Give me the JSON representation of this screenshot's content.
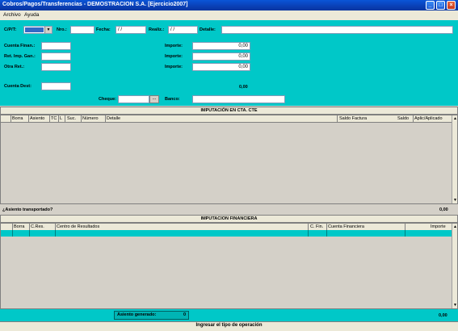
{
  "window": {
    "title": "Cobros/Pagos/Transferencias - DEMOSTRACION S.A.  [Ejercicio2007]",
    "minimize_glyph": "_",
    "maximize_glyph": "□",
    "close_glyph": "×"
  },
  "menu": {
    "file": "Archivo",
    "help": "Ayuda"
  },
  "form": {
    "cpt_label": "C/P/T:",
    "nro_label": "Nro.:",
    "fecha_label": "Fecha:",
    "fecha_value": " / /",
    "realiz_label": "Realiz.:",
    "realiz_value": " / /",
    "detalle_label": "Detalle:",
    "cuenta_finan_label": "Cuenta Finan.:",
    "ret_imp_label": "Ret. Imp. Gan.:",
    "otra_ret_label": "Otra Ret.:",
    "importe_label_1": "Importe:",
    "importe_label_2": "Importe:",
    "importe_label_3": "Importe:",
    "importe_value_1": "0,00",
    "importe_value_2": "0,00",
    "importe_value_3": "0,00",
    "cuenta_dest_label": "Cuenta Dest:",
    "total_value": "0,00",
    "cheque_label": "Cheque:",
    "cheque_button": "...",
    "banco_label": "Banco:"
  },
  "cta_cte": {
    "header": "IMPUTACIÓN EN CTA. CTE",
    "columns": [
      "Borra",
      "Asiento",
      "TC",
      "L",
      "Suc.",
      "Número",
      "Detalle",
      "Saldo Factura",
      "Saldo",
      "Aplic/Aplicado"
    ],
    "transported_label": "¿Asiento transportado?",
    "transported_value": "0,00"
  },
  "financiera": {
    "header": "IMPUTACION FINANCIERA",
    "columns": [
      "Borra",
      "C.Res.",
      "Centro de Resultados",
      "C. Fin.",
      "Cuenta Financiera",
      "Importe"
    ]
  },
  "footer": {
    "asiento_label": "Asiento generado:",
    "asiento_value": "0",
    "total_value": "0,00"
  },
  "status": {
    "message": "Ingresar el tipo de operación"
  }
}
